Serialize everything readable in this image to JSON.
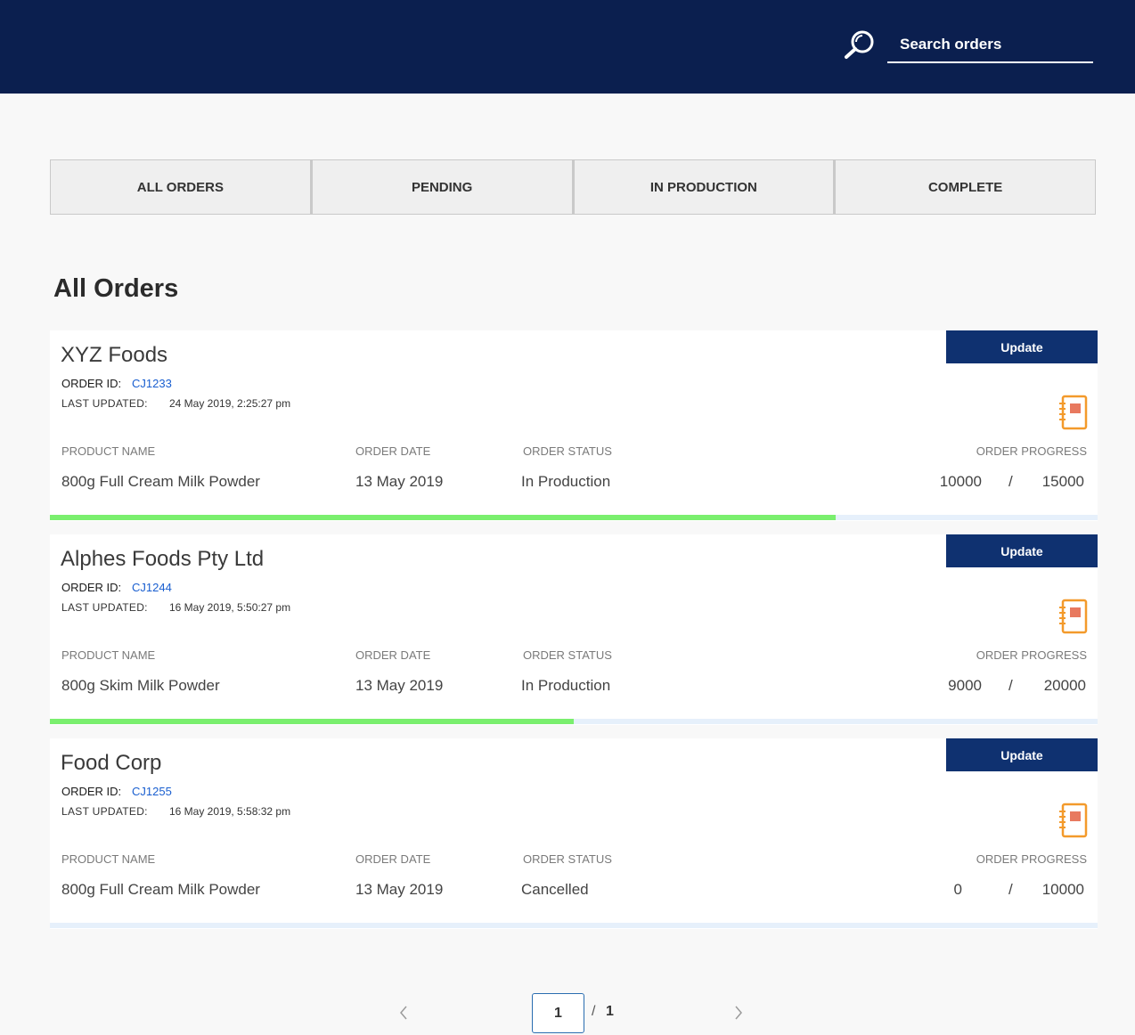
{
  "header": {
    "search_placeholder": "Search orders"
  },
  "tabs": [
    {
      "label": "ALL ORDERS"
    },
    {
      "label": "PENDING"
    },
    {
      "label": "IN PRODUCTION"
    },
    {
      "label": "COMPLETE"
    }
  ],
  "page_title": "All Orders",
  "labels": {
    "order_id": "ORDER ID:",
    "last_updated": "LAST UPDATED:",
    "product_name": "PRODUCT NAME",
    "order_date": "ORDER DATE",
    "order_status": "ORDER STATUS",
    "order_progress": "ORDER PROGRESS",
    "update_button": "Update",
    "progress_separator": "/"
  },
  "orders": [
    {
      "company": "XYZ Foods",
      "order_id": "CJ1233",
      "last_updated": "24 May 2019, 2:25:27 pm",
      "product_name": "800g Full Cream Milk Powder",
      "order_date": "13 May 2019",
      "order_status": "In Production",
      "progress_current": "10000",
      "progress_total": "15000",
      "progress_fraction": 0.75
    },
    {
      "company": "Alphes Foods Pty Ltd",
      "order_id": "CJ1244",
      "last_updated": "16 May 2019, 5:50:27 pm",
      "product_name": "800g Skim Milk Powder",
      "order_date": "13 May 2019",
      "order_status": "In Production",
      "progress_current": "9000",
      "progress_total": "20000",
      "progress_fraction": 0.5
    },
    {
      "company": "Food Corp",
      "order_id": "CJ1255",
      "last_updated": "16 May 2019, 5:58:32 pm",
      "product_name": "800g Full Cream Milk Powder",
      "order_date": "13 May 2019",
      "order_status": "Cancelled",
      "progress_current": "0",
      "progress_total": "10000",
      "progress_fraction": 0
    }
  ],
  "pagination": {
    "current_page": "1",
    "separator": "/",
    "total_pages": "1"
  },
  "colors": {
    "header_bg": "#0b1f4f",
    "update_button_bg": "#0f3170",
    "progress_fill": "#7aef6e",
    "progress_track": "#e6f0fb",
    "order_id_link": "#1a5fd0",
    "notebook_icon": "#f39a2b"
  }
}
